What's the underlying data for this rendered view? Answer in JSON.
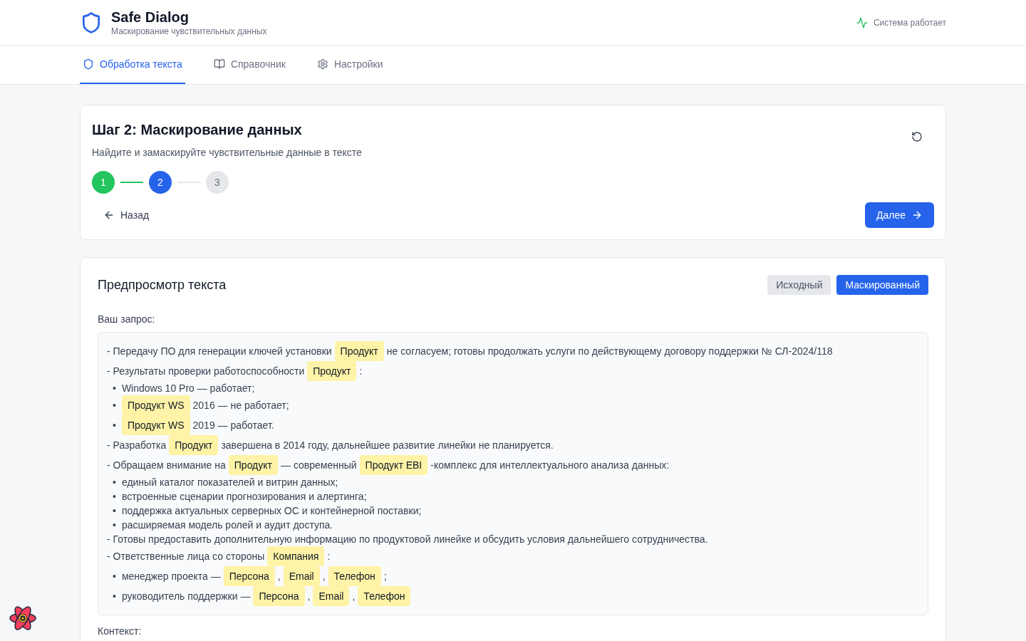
{
  "app": {
    "title": "Safe Dialog",
    "subtitle": "Маскирование чувствительных данных",
    "status": "Система работает"
  },
  "tabs": [
    {
      "label": "Обработка текста",
      "kind": "shield",
      "selected": true
    },
    {
      "label": "Справочник",
      "kind": "book",
      "selected": false
    },
    {
      "label": "Настройки",
      "kind": "gear",
      "selected": false
    }
  ],
  "step_card": {
    "title": "Шаг 2: Маскирование данных",
    "description": "Найдите и замаскируйте чувствительные данные в тексте",
    "steps": [
      {
        "label": "1",
        "kind": "done"
      },
      {
        "label": "2",
        "kind": "current"
      },
      {
        "label": "3",
        "kind": "pending"
      }
    ],
    "back_button": "Назад",
    "next_button": "Далее"
  },
  "preview": {
    "title": "Предпросмотр текста",
    "views": [
      {
        "label": "Исходный",
        "selected": false
      },
      {
        "label": "Маскированный",
        "selected": true
      }
    ],
    "query_label": "Ваш запрос:",
    "lines": [
      {
        "kind": "item",
        "segments": [
          {
            "kind": "text",
            "text": "- Передачу ПО для генерации ключей установки"
          },
          {
            "kind": "tag",
            "text": "Продукт"
          },
          {
            "kind": "text",
            "text": "не согласуем; готовы продолжать услуги по действующему договору поддержки № СЛ-2024/118"
          }
        ]
      },
      {
        "kind": "item",
        "segments": [
          {
            "kind": "text",
            "text": "- Результаты проверки работоспособности"
          },
          {
            "kind": "tag",
            "text": "Продукт"
          },
          {
            "kind": "text",
            "text": ":"
          }
        ]
      },
      {
        "kind": "sub",
        "marker": "•",
        "segments": [
          {
            "kind": "text",
            "text": "Windows 10 Pro — работает;"
          }
        ]
      },
      {
        "kind": "sub",
        "marker": "•",
        "segments": [
          {
            "kind": "tag",
            "text": "Продукт WS"
          },
          {
            "kind": "text",
            "text": "2016 — не работает;"
          }
        ]
      },
      {
        "kind": "sub",
        "marker": "•",
        "segments": [
          {
            "kind": "tag",
            "text": "Продукт WS"
          },
          {
            "kind": "text",
            "text": "2019 — работает."
          }
        ]
      },
      {
        "kind": "item",
        "segments": [
          {
            "kind": "text",
            "text": "- Разработка"
          },
          {
            "kind": "tag",
            "text": "Продукт"
          },
          {
            "kind": "text",
            "text": "завершена в 2014 году, дальнейшее развитие линейки не планируется."
          }
        ]
      },
      {
        "kind": "item",
        "segments": [
          {
            "kind": "text",
            "text": "- Обращаем внимание на"
          },
          {
            "kind": "tag",
            "text": "Продукт"
          },
          {
            "kind": "text",
            "text": "— современный"
          },
          {
            "kind": "tag",
            "text": "Продукт EBI"
          },
          {
            "kind": "text",
            "text": "-комплекс для интеллектуального анализа данных:"
          }
        ]
      },
      {
        "kind": "sub",
        "marker": "•",
        "segments": [
          {
            "kind": "text",
            "text": "единый каталог показателей и витрин данных;"
          }
        ]
      },
      {
        "kind": "sub",
        "marker": "•",
        "segments": [
          {
            "kind": "text",
            "text": "встроенные сценарии прогнозирования и алертинга;"
          }
        ]
      },
      {
        "kind": "sub",
        "marker": "•",
        "segments": [
          {
            "kind": "text",
            "text": "поддержка актуальных серверных ОС и контейнерной поставки;"
          }
        ]
      },
      {
        "kind": "sub",
        "marker": "•",
        "segments": [
          {
            "kind": "text",
            "text": "расширяемая модель ролей и аудит доступа."
          }
        ]
      },
      {
        "kind": "item",
        "segments": [
          {
            "kind": "text",
            "text": "- Готовы предоставить дополнительную информацию по продуктовой линейке и обсудить условия дальнейшего сотрудничества."
          }
        ]
      },
      {
        "kind": "item",
        "segments": [
          {
            "kind": "text",
            "text": "- Ответственные лица со стороны"
          },
          {
            "kind": "tag",
            "text": "Компания"
          },
          {
            "kind": "text",
            "text": ":"
          }
        ]
      },
      {
        "kind": "sub",
        "marker": "•",
        "segments": [
          {
            "kind": "text",
            "text": "менеджер проекта —"
          },
          {
            "kind": "tag",
            "text": "Персона"
          },
          {
            "kind": "text",
            "text": ","
          },
          {
            "kind": "tag",
            "text": "Email"
          },
          {
            "kind": "text",
            "text": ","
          },
          {
            "kind": "tag",
            "text": "Телефон"
          },
          {
            "kind": "text",
            "text": ";"
          }
        ]
      },
      {
        "kind": "sub",
        "marker": "•",
        "segments": [
          {
            "kind": "text",
            "text": "руководитель поддержки —"
          },
          {
            "kind": "tag",
            "text": "Персона"
          },
          {
            "kind": "text",
            "text": ","
          },
          {
            "kind": "tag",
            "text": "Email"
          },
          {
            "kind": "text",
            "text": ","
          },
          {
            "kind": "tag",
            "text": "Телефон"
          }
        ]
      }
    ],
    "context_label": "Контекст:"
  }
}
